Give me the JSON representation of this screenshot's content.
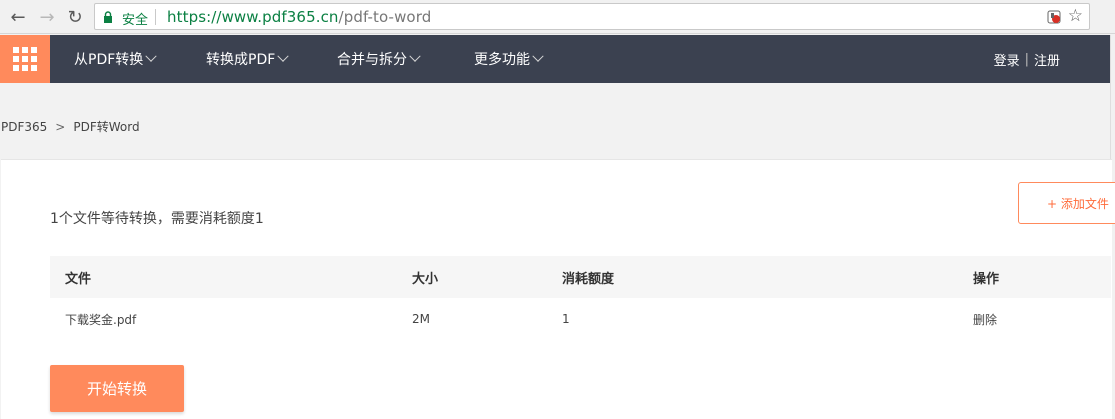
{
  "browser": {
    "secure_label": "安全",
    "url_host": "https://www.pdf365.cn",
    "url_path": "/pdf-to-word"
  },
  "nav": {
    "menu": [
      {
        "label": "从PDF转换"
      },
      {
        "label": "转换成PDF"
      },
      {
        "label": "合并与拆分"
      },
      {
        "label": "更多功能"
      }
    ],
    "login": "登录",
    "divider": "|",
    "register": "注册"
  },
  "breadcrumb": {
    "home": "PDF365",
    "separator": ">",
    "current": "PDF转Word"
  },
  "main": {
    "summary": "1个文件等待转换，需要消耗额度1",
    "add_file_label": "+ 添加文件",
    "table": {
      "headers": [
        "文件",
        "大小",
        "消耗额度",
        "操作"
      ],
      "rows": [
        [
          "下载奖金.pdf",
          "2M",
          "1",
          "删除"
        ]
      ]
    },
    "start_label": "开始转换"
  },
  "colors": {
    "accent": "#ff8a5c",
    "nav_bg": "#3b4150",
    "secure_green": "#0b8043"
  }
}
